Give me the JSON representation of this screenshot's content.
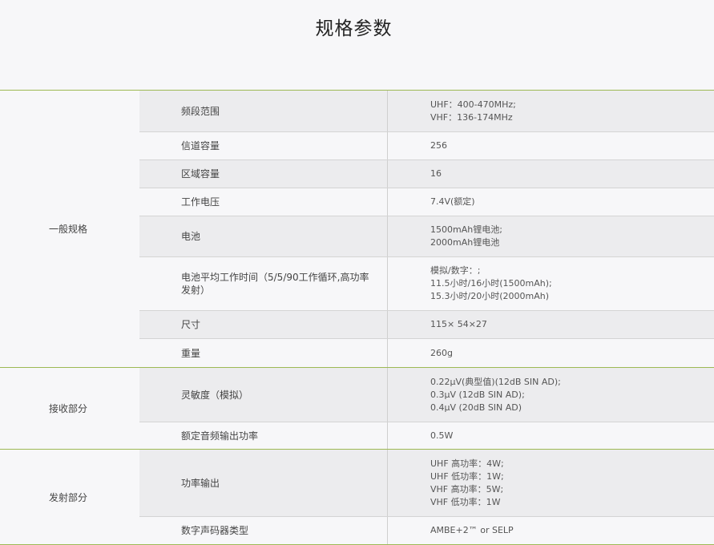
{
  "page_title": "规格参数",
  "groups": [
    {
      "label": "一般规格",
      "rows": [
        {
          "name": "频段范围",
          "values": [
            "UHF：400-470MHz;",
            "VHF：136-174MHz"
          ]
        },
        {
          "name": "信道容量",
          "values": [
            "256"
          ]
        },
        {
          "name": "区域容量",
          "values": [
            "16"
          ]
        },
        {
          "name": "工作电压",
          "values": [
            "7.4V(额定)"
          ]
        },
        {
          "name": "电池",
          "values": [
            "1500mAh锂电池;",
            "2000mAh锂电池"
          ]
        },
        {
          "name": "电池平均工作时间（5/5/90工作循环,高功率发射）",
          "values": [
            "模拟/数字：;",
            "11.5小时/16小时(1500mAh);",
            "15.3小时/20小时(2000mAh)"
          ]
        },
        {
          "name": "尺寸",
          "values": [
            "115× 54×27"
          ]
        },
        {
          "name": "重量",
          "values": [
            "260g"
          ]
        }
      ]
    },
    {
      "label": "接收部分",
      "rows": [
        {
          "name": "灵敏度（模拟）",
          "values": [
            "0.22µV(典型值)(12dB SIN AD);",
            "0.3µV (12dB SIN AD);",
            "0.4µV (20dB SIN AD)"
          ]
        },
        {
          "name": "额定音频输出功率",
          "values": [
            "0.5W"
          ]
        }
      ]
    },
    {
      "label": "发射部分",
      "rows": [
        {
          "name": "功率输出",
          "values": [
            "UHF 高功率：4W;",
            "UHF 低功率：1W;",
            "VHF 高功率：5W;",
            "VHF 低功率：1W"
          ]
        },
        {
          "name": "数字声码器类型",
          "values": [
            "AMBE+2™ or SELP"
          ]
        }
      ]
    }
  ]
}
